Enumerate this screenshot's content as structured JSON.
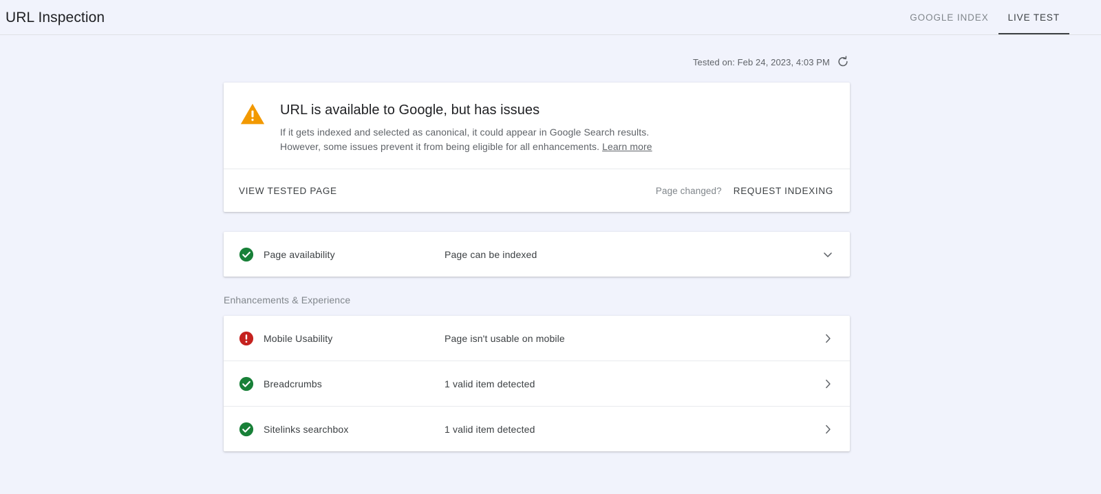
{
  "header": {
    "title": "URL Inspection",
    "tabs": [
      {
        "label": "GOOGLE INDEX",
        "active": false
      },
      {
        "label": "LIVE TEST",
        "active": true
      }
    ]
  },
  "tested": {
    "text": "Tested on: Feb 24, 2023, 4:03 PM",
    "refresh_icon": "refresh-icon"
  },
  "alert": {
    "icon": "warning-triangle-icon",
    "icon_color": "#F29900",
    "title": "URL is available to Google, but has issues",
    "description_line1": "If it gets indexed and selected as canonical, it could appear in Google Search results.",
    "description_line2": "However, some issues prevent it from being eligible for all enhancements.",
    "learn_more": "Learn more"
  },
  "actions": {
    "view_tested_page": "VIEW TESTED PAGE",
    "page_changed": "Page changed?",
    "request_indexing": "REQUEST INDEXING"
  },
  "availability": {
    "icon": "check-circle-icon",
    "icon_color": "#188038",
    "label": "Page availability",
    "value": "Page can be indexed",
    "chevron": "chevron-down-icon"
  },
  "enhancements": {
    "section_label": "Enhancements & Experience",
    "rows": [
      {
        "icon": "error-circle-icon",
        "icon_color": "#C5221F",
        "label": "Mobile Usability",
        "value": "Page isn't usable on mobile",
        "chevron": "chevron-right-icon"
      },
      {
        "icon": "check-circle-icon",
        "icon_color": "#188038",
        "label": "Breadcrumbs",
        "value": "1 valid item detected",
        "chevron": "chevron-right-icon"
      },
      {
        "icon": "check-circle-icon",
        "icon_color": "#188038",
        "label": "Sitelinks searchbox",
        "value": "1 valid item detected",
        "chevron": "chevron-right-icon"
      }
    ]
  },
  "colors": {
    "background": "#F1F3FC",
    "card": "#FFFFFF",
    "warning": "#F29900",
    "success": "#188038",
    "error": "#C5221F",
    "text_primary": "#3C4043",
    "text_secondary": "#5F6368",
    "text_muted": "#80868B"
  }
}
